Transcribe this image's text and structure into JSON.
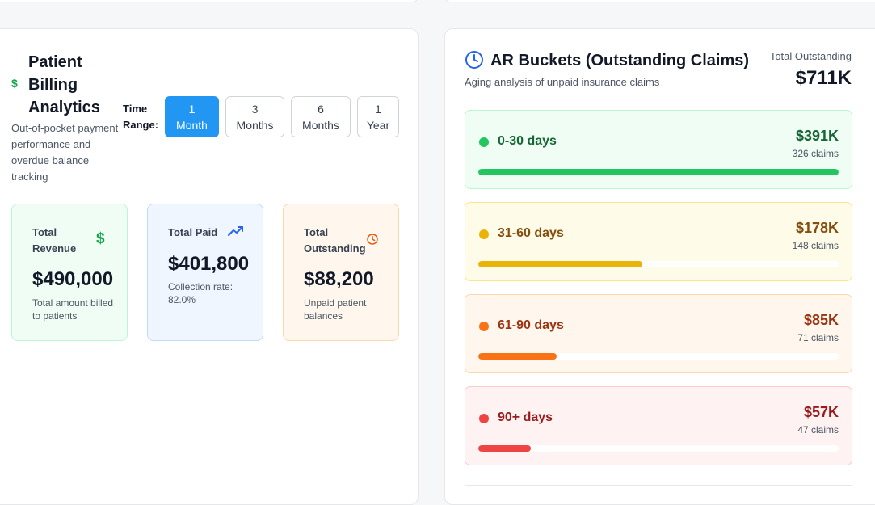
{
  "billing": {
    "title": "Patient Billing Analytics",
    "subtitle": "Out-of-pocket payment performance and overdue balance tracking",
    "time_range_label": "Time Range:",
    "ranges": [
      {
        "num": "1",
        "unit": "Month",
        "active": true
      },
      {
        "num": "3",
        "unit": "Months",
        "active": false
      },
      {
        "num": "6",
        "unit": "Months",
        "active": false
      },
      {
        "num": "1",
        "unit": "Year",
        "active": false
      }
    ],
    "metrics": [
      {
        "label": "Total Revenue",
        "value": "$490,000",
        "desc": "Total amount billed to patients",
        "icon": "dollar-icon",
        "accent": "#16a34a",
        "bg": "#f0fdf4",
        "border": "#bbf7d0"
      },
      {
        "label": "Total Paid",
        "value": "$401,800",
        "desc": "Collection rate: 82.0%",
        "icon": "trending-up-icon",
        "accent": "#2563eb",
        "bg": "#eff6ff",
        "border": "#bfdbfe"
      },
      {
        "label": "Total Outstanding",
        "value": "$88,200",
        "desc": "Unpaid patient balances",
        "icon": "clock-icon",
        "accent": "#ea580c",
        "bg": "#fff7ed",
        "border": "#fed7aa"
      }
    ]
  },
  "ar": {
    "title": "AR Buckets (Outstanding Claims)",
    "subtitle": "Aging analysis of unpaid insurance claims",
    "total_label": "Total Outstanding",
    "total_value": "$711K",
    "buckets": [
      {
        "label": "0-30 days",
        "amount": "$391K",
        "claims": "326 claims",
        "fraction": 1.0,
        "color": "#22c55e",
        "text": "#166534",
        "bg": "#f0fdf4",
        "border": "#bbf7d0"
      },
      {
        "label": "31-60 days",
        "amount": "$178K",
        "claims": "148 claims",
        "fraction": 0.455,
        "color": "#eab308",
        "text": "#854d0e",
        "bg": "#fefce8",
        "border": "#fde68a"
      },
      {
        "label": "61-90 days",
        "amount": "$85K",
        "claims": "71 claims",
        "fraction": 0.218,
        "color": "#f97316",
        "text": "#9a3412",
        "bg": "#fff7ed",
        "border": "#fed7aa"
      },
      {
        "label": "90+ days",
        "amount": "$57K",
        "claims": "47 claims",
        "fraction": 0.146,
        "color": "#ef4444",
        "text": "#991b1b",
        "bg": "#fef2f2",
        "border": "#fecaca"
      }
    ]
  }
}
